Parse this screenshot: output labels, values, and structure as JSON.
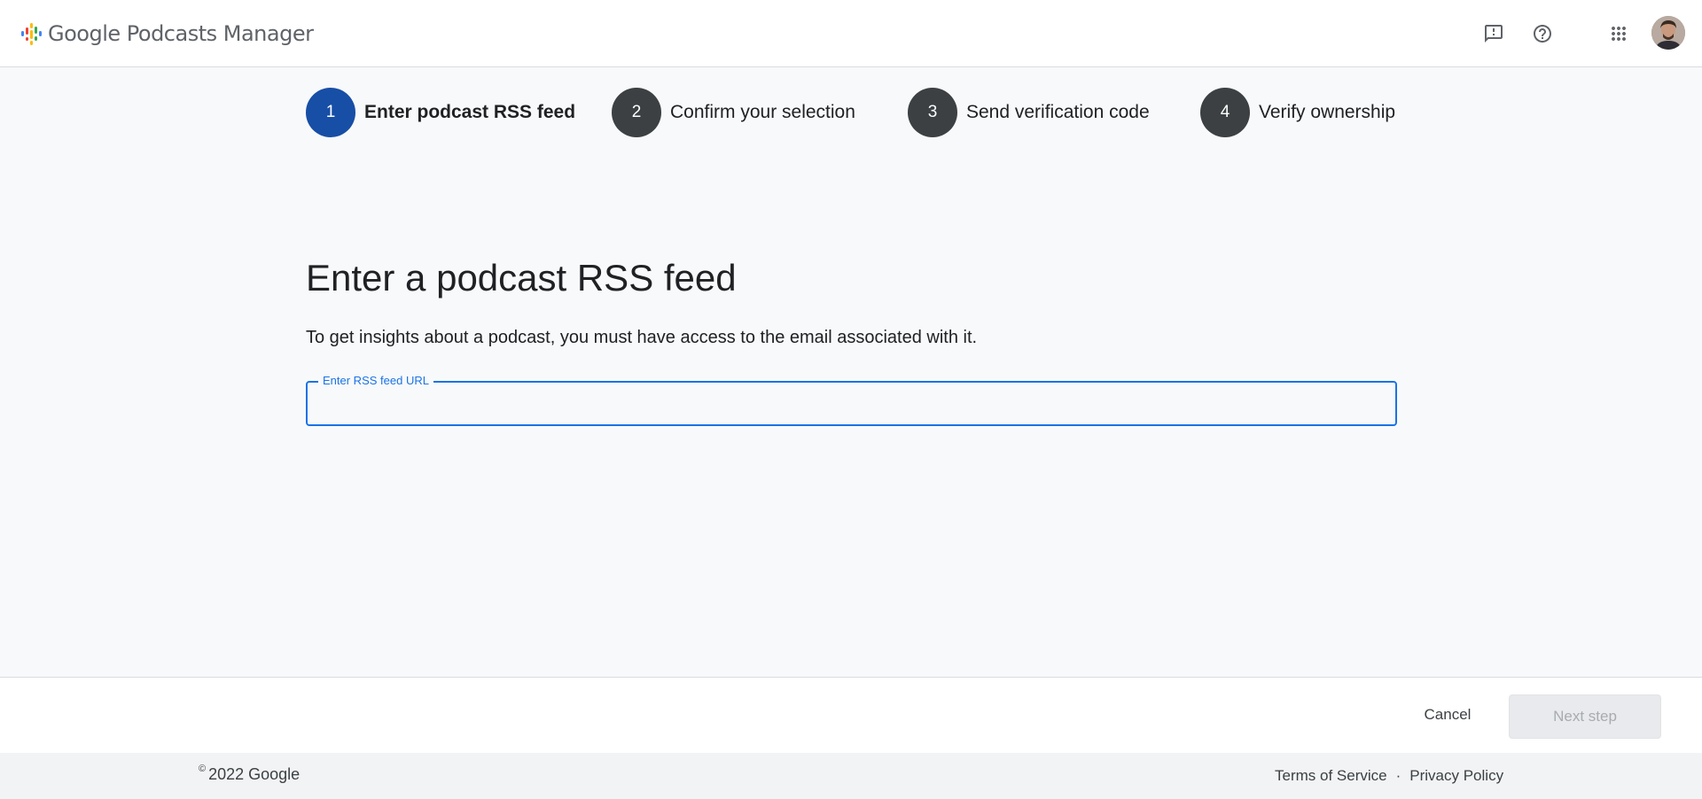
{
  "header": {
    "app_title": "Google Podcasts Manager",
    "icons": [
      "feedback-icon",
      "help-icon",
      "apps-icon"
    ]
  },
  "stepper": {
    "active_step": 1,
    "steps": [
      {
        "number": "1",
        "label": "Enter podcast RSS feed"
      },
      {
        "number": "2",
        "label": "Confirm your selection"
      },
      {
        "number": "3",
        "label": "Send verification code"
      },
      {
        "number": "4",
        "label": "Verify ownership"
      }
    ]
  },
  "main": {
    "title": "Enter a podcast RSS feed",
    "description": "To get insights about a podcast, you must have access to the email associated with it.",
    "rss_field": {
      "label": "Enter RSS feed URL",
      "value": ""
    }
  },
  "actions": {
    "cancel_label": "Cancel",
    "next_label": "Next step"
  },
  "footer": {
    "copyright_symbol": "©",
    "copyright_text": "2022 Google",
    "terms_label": "Terms of Service",
    "separator": "·",
    "privacy_label": "Privacy Policy"
  },
  "colors": {
    "active_step": "#174ea6",
    "inactive_step": "#3c4043",
    "focus_blue": "#1a73e8",
    "page_bg": "#f8f9fa"
  }
}
